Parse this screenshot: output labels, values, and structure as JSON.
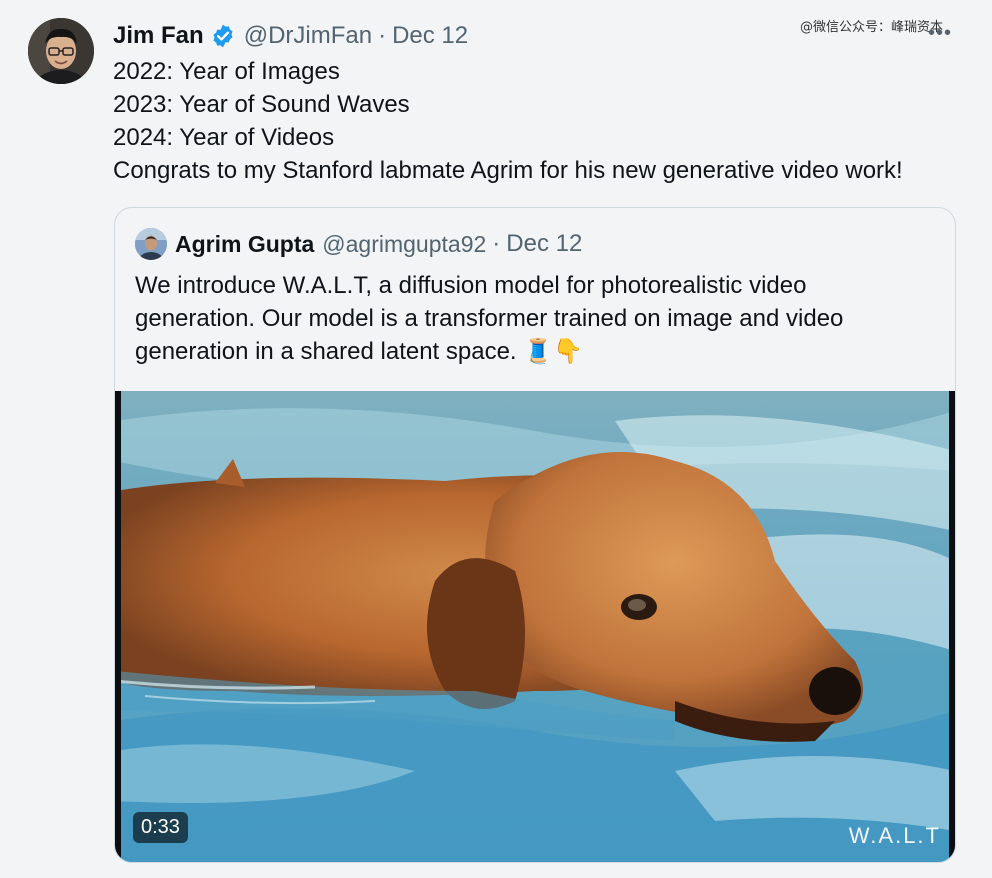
{
  "author": {
    "name": "Jim Fan",
    "handle": "@DrJimFan",
    "date": "Dec 12",
    "verified_icon": "verified-badge-icon"
  },
  "watermark": "@微信公众号：峰瑞资本",
  "more_menu": "•••",
  "tweet_lines": [
    "2022: Year of Images",
    "2023: Year of Sound Waves",
    "2024: Year of Videos",
    "Congrats to my Stanford labmate Agrim for his new generative video work!"
  ],
  "quote": {
    "name": "Agrim Gupta",
    "handle": "@agrimgupta92",
    "date": "Dec 12",
    "lines": [
      "We introduce W.A.L.T, a diffusion model for photorealistic video",
      "generation. Our model is a transformer trained on image and video",
      "generation in a shared latent space. 🧵👇"
    ],
    "video": {
      "duration": "0:33",
      "overlay_label": "W.A.L.T"
    }
  },
  "colors": {
    "background": "#f2f4f5",
    "text": "#0f1419",
    "secondary_text": "#536471",
    "verified_blue": "#1d9bf0",
    "border": "#cfd9de"
  }
}
